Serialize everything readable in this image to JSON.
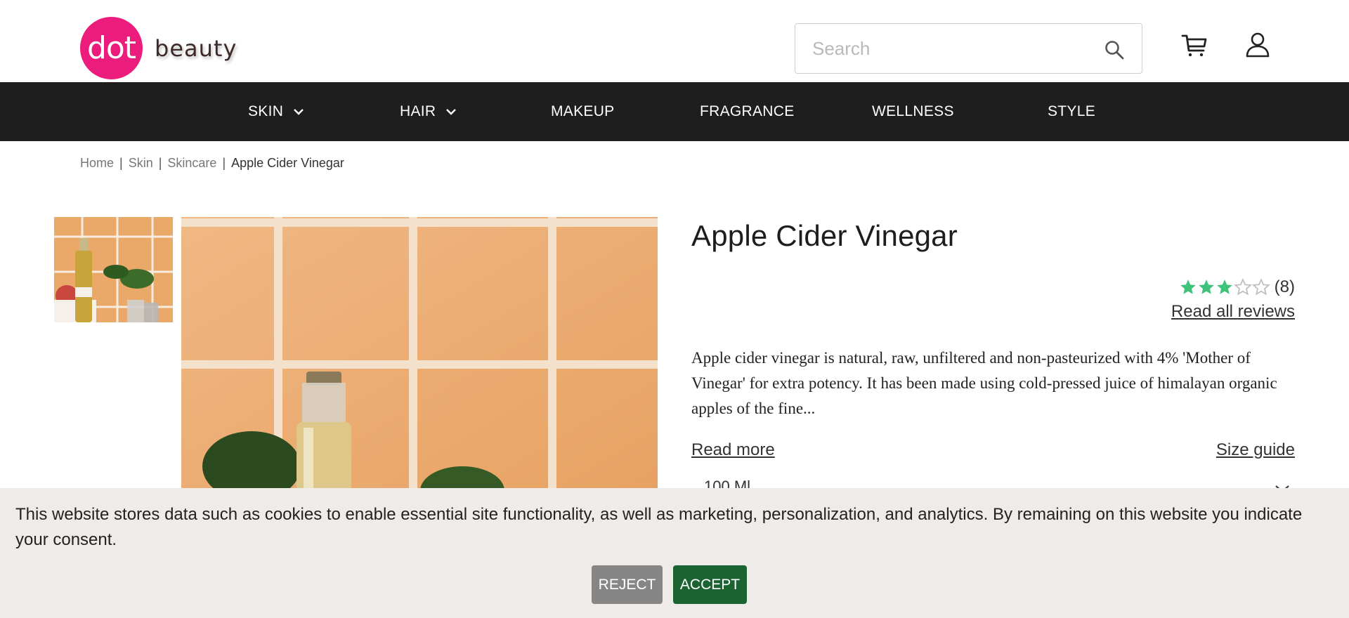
{
  "header": {
    "logo_mark": "dot",
    "logo_text": "beauty",
    "search_placeholder": "Search",
    "icons": {
      "search": "search-icon",
      "cart": "cart-icon",
      "user": "user-icon"
    }
  },
  "nav": {
    "items": [
      {
        "label": "SKIN",
        "has_dropdown": true
      },
      {
        "label": "HAIR",
        "has_dropdown": true
      },
      {
        "label": "MAKEUP",
        "has_dropdown": false
      },
      {
        "label": "FRAGRANCE",
        "has_dropdown": false
      },
      {
        "label": "WELLNESS",
        "has_dropdown": false
      },
      {
        "label": "STYLE",
        "has_dropdown": false
      }
    ]
  },
  "breadcrumb": {
    "items": [
      "Home",
      "Skin",
      "Skincare"
    ],
    "current": "Apple Cider Vinegar",
    "separator": "|"
  },
  "product": {
    "title": "Apple Cider Vinegar",
    "rating": 3,
    "rating_max": 5,
    "review_count": "(8)",
    "read_all_reviews": "Read all reviews",
    "description": "Apple cider vinegar is natural, raw, unfiltered and non-pasteurized with 4% 'Mother of Vinegar' for extra potency. It has been made using cold-pressed juice of himalayan organic apples of the fine...",
    "read_more": "Read more",
    "size_guide": "Size guide",
    "size_selected": "100 Ml"
  },
  "cookie_banner": {
    "text": "This website stores data such as cookies to enable essential site functionality, as well as marketing, personalization, and analytics. By remaining on this website you indicate your consent.",
    "reject_label": "REJECT",
    "accept_label": "ACCEPT"
  },
  "colors": {
    "brand_pink": "#ec1c7c",
    "nav_bg": "#1e1e1e",
    "star_filled": "#3fc27a",
    "star_empty": "#bdbdbd",
    "accept_green": "#1b6431",
    "reject_gray": "#868686",
    "banner_bg": "#efebe9"
  }
}
